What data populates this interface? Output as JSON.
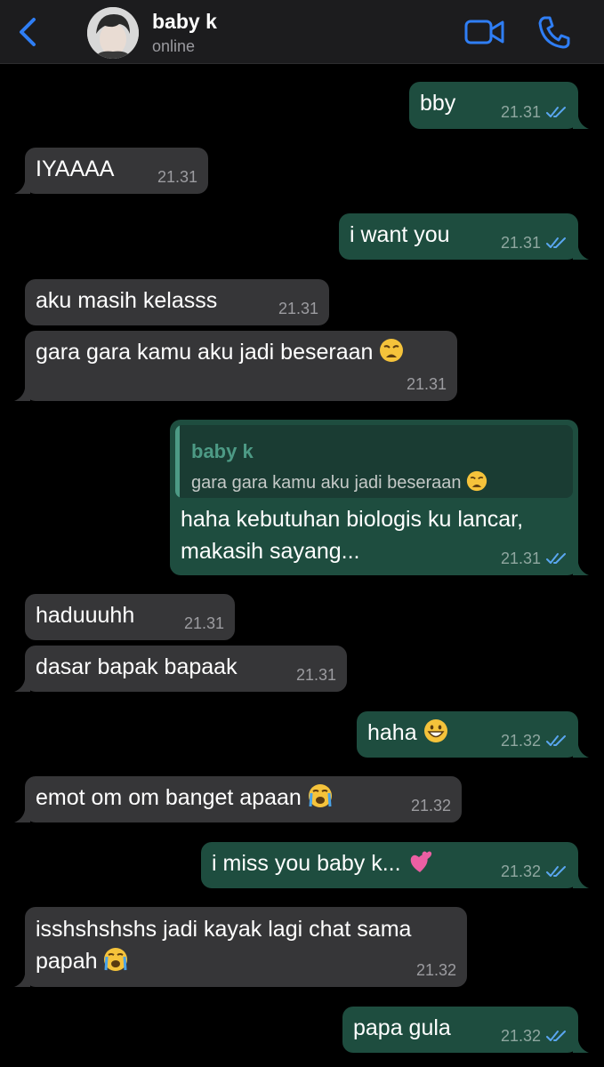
{
  "header": {
    "contact_name": "baby k",
    "status": "online",
    "icons": [
      "back-chevron-icon",
      "avatar-photo",
      "video-camera-icon",
      "phone-icon"
    ],
    "accent_color": "#2f7ef5"
  },
  "messages": [
    {
      "dir": "out",
      "text": "bby",
      "time": "21.31"
    },
    {
      "dir": "in",
      "text": "IYAAAA",
      "time": "21.31"
    },
    {
      "dir": "out",
      "text": "i want you",
      "time": "21.31"
    },
    {
      "dir": "in",
      "text": "aku masih kelasss",
      "time": "21.31"
    },
    {
      "dir": "in",
      "text": "gara gara kamu aku jadi beseraan",
      "emoji": "weary-face",
      "time": "21.31"
    },
    {
      "dir": "out",
      "reply_to": {
        "name": "baby k",
        "text": "gara gara kamu aku jadi beseraan",
        "emoji": "weary-face"
      },
      "line1": "haha kebutuhan biologis ku lancar,",
      "line2": "makasih sayang...",
      "time": "21.31"
    },
    {
      "dir": "in",
      "text": "haduuuhh",
      "time": "21.31"
    },
    {
      "dir": "in",
      "text": "dasar bapak bapaak",
      "time": "21.31"
    },
    {
      "dir": "out",
      "text": "haha",
      "emoji": "grinning-face",
      "time": "21.32"
    },
    {
      "dir": "in",
      "text": "emot om om banget apaan",
      "emoji": "loudly-crying-face",
      "time": "21.32"
    },
    {
      "dir": "out",
      "text": "i miss you baby k...",
      "emoji": "two-hearts",
      "time": "21.32"
    },
    {
      "dir": "in",
      "line1": "isshshshshs jadi kayak lagi chat sama",
      "line2": "papah",
      "emoji": "loudly-crying-face",
      "time": "21.32"
    },
    {
      "dir": "out",
      "text": "papa gula",
      "time": "21.32"
    }
  ],
  "colors": {
    "incoming_bubble": "#363638",
    "outgoing_bubble": "#1e4d3f",
    "read_ticks": "#5aa6f0"
  }
}
